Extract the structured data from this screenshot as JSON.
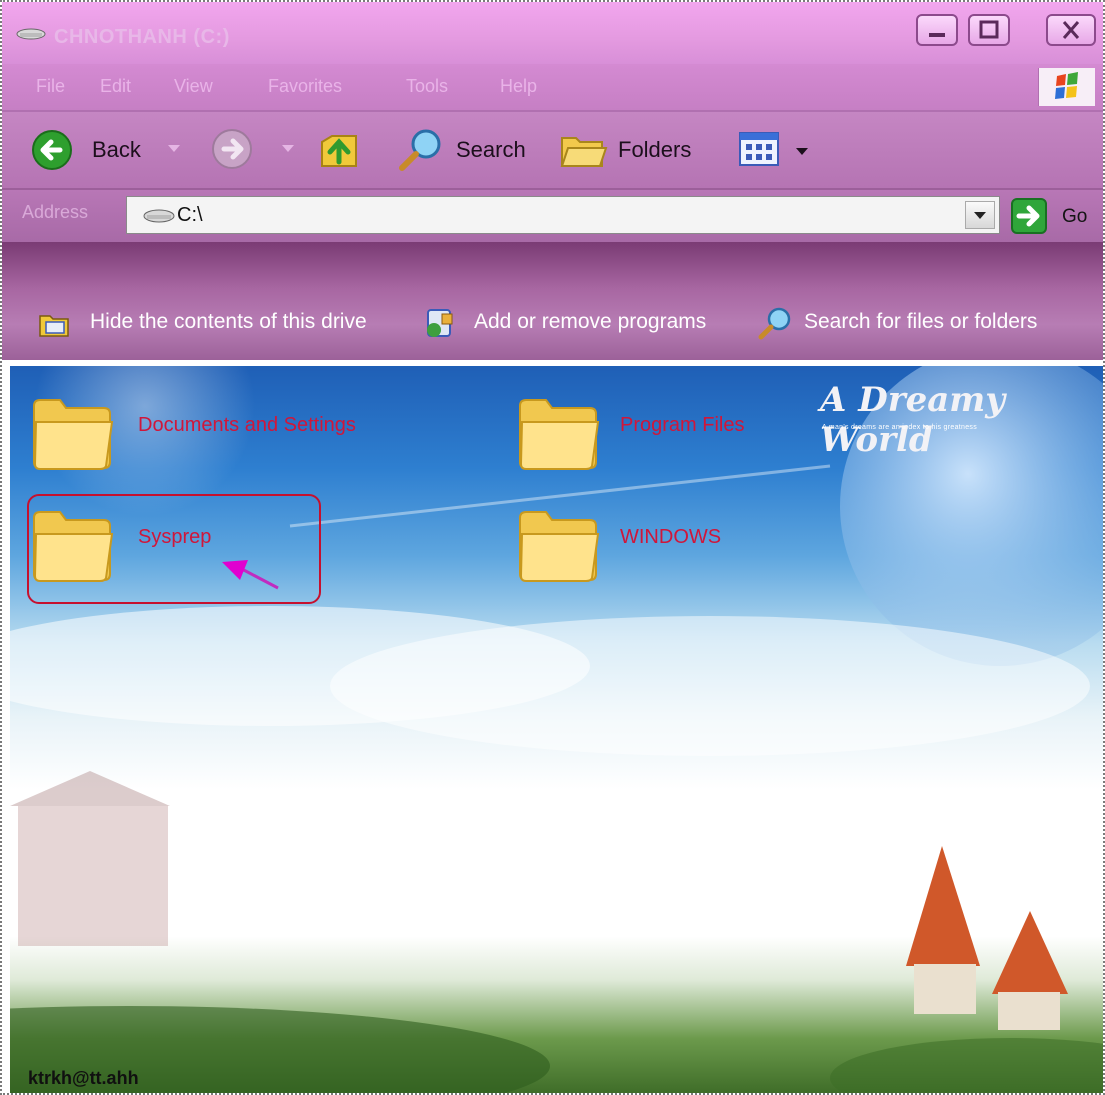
{
  "window": {
    "title": "CHNOTHANH (C:)",
    "caption_buttons": [
      "minimize",
      "maximize",
      "close"
    ]
  },
  "menu": {
    "items": [
      "File",
      "Edit",
      "View",
      "Favorites",
      "Tools",
      "Help"
    ]
  },
  "toolbar": {
    "back_label": "Back",
    "search_label": "Search",
    "folders_label": "Folders"
  },
  "address": {
    "label": "Address",
    "value": "C:\\",
    "go_label": "Go"
  },
  "tasks": {
    "hide_contents": "Hide the contents of this drive",
    "add_remove": "Add or remove programs",
    "search_files": "Search for files or folders"
  },
  "content": {
    "folders": [
      {
        "name": "Documents and Settings"
      },
      {
        "name": "Program Files"
      },
      {
        "name": "Sysprep"
      },
      {
        "name": "WINDOWS"
      }
    ],
    "wallpaper_title": "A Dreamy World",
    "wallpaper_subtitle": "A man's dreams are an index to his greatness",
    "bottom_text": "ktrkh@tt.ahh"
  },
  "colors": {
    "frame": "#e49ae0",
    "toolbar": "#b574b3",
    "task_band": "#8a4d84",
    "folder_label": "#d0163a",
    "annotation": "#e000d0"
  }
}
